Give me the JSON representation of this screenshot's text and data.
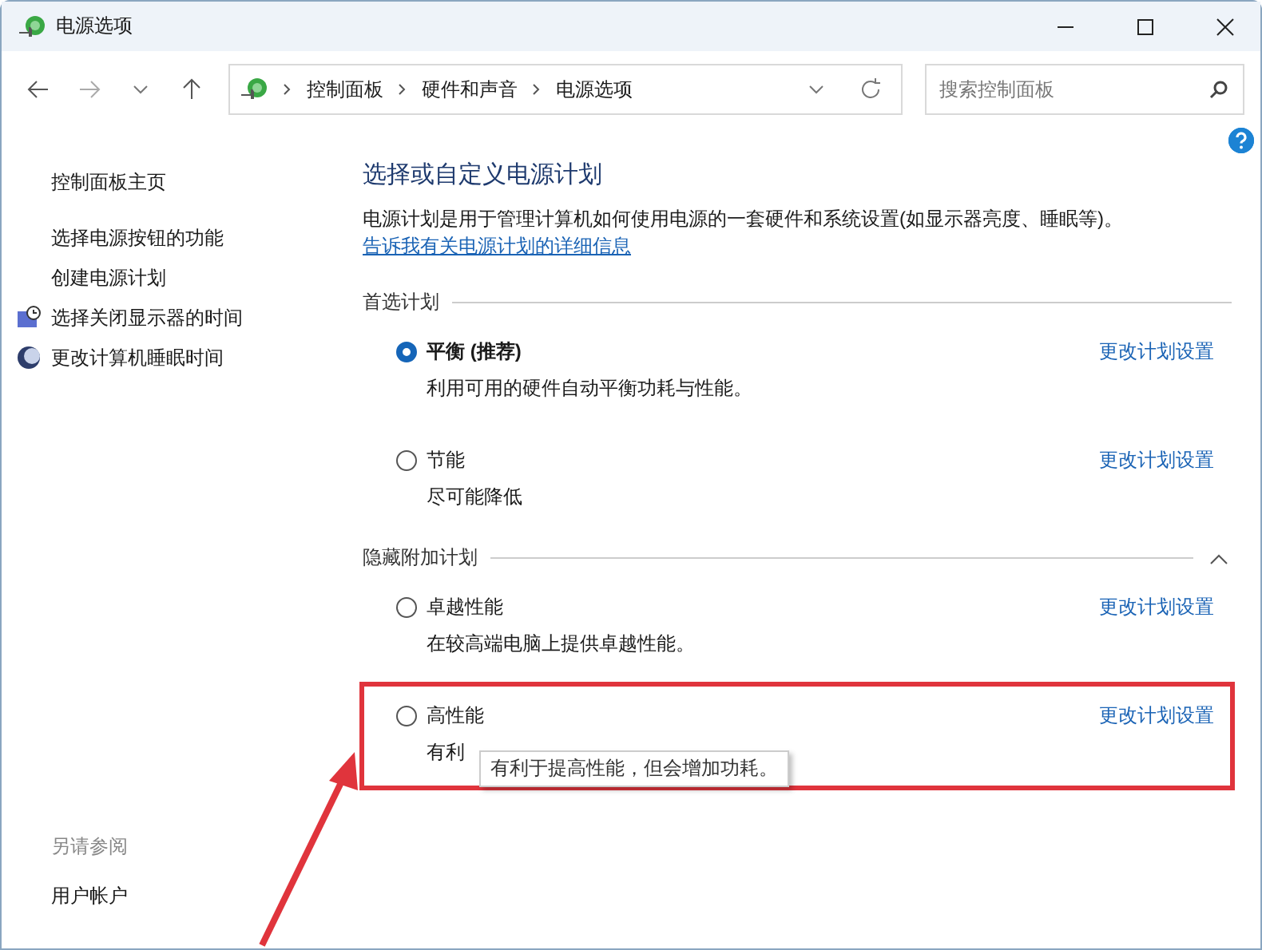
{
  "window": {
    "title": "电源选项"
  },
  "address": {
    "crumbs": [
      "控制面板",
      "硬件和声音",
      "电源选项"
    ]
  },
  "search": {
    "placeholder": "搜索控制面板"
  },
  "sidebar": {
    "home": "控制面板主页",
    "items": [
      {
        "label": "选择电源按钮的功能"
      },
      {
        "label": "创建电源计划"
      },
      {
        "label": "选择关闭显示器的时间"
      },
      {
        "label": "更改计算机睡眠时间"
      }
    ],
    "see_also": {
      "title": "另请参阅",
      "items": [
        "用户帐户"
      ]
    }
  },
  "main": {
    "heading": "选择或自定义电源计划",
    "intro": "电源计划是用于管理计算机如何使用电源的一套硬件和系统设置(如显示器亮度、睡眠等)。",
    "intro_link": "告诉我有关电源计划的详细信息",
    "groups": [
      {
        "title": "首选计划",
        "plans": [
          {
            "name": "平衡 (推荐)",
            "description": "利用可用的硬件自动平衡功耗与性能。",
            "selected": true,
            "link": "更改计划设置",
            "highlighted": false
          },
          {
            "name": "节能",
            "description": "尽可能降低",
            "selected": false,
            "link": "更改计划设置",
            "highlighted": false
          }
        ]
      },
      {
        "title": "隐藏附加计划",
        "expanded": true,
        "plans": [
          {
            "name": "卓越性能",
            "description": "在较高端电脑上提供卓越性能。",
            "selected": false,
            "link": "更改计划设置",
            "highlighted": false
          },
          {
            "name": "高性能",
            "description": "有利",
            "selected": false,
            "link": "更改计划设置",
            "highlighted": true,
            "tooltip": "有利于提高性能，但会增加功耗。"
          }
        ]
      }
    ]
  }
}
